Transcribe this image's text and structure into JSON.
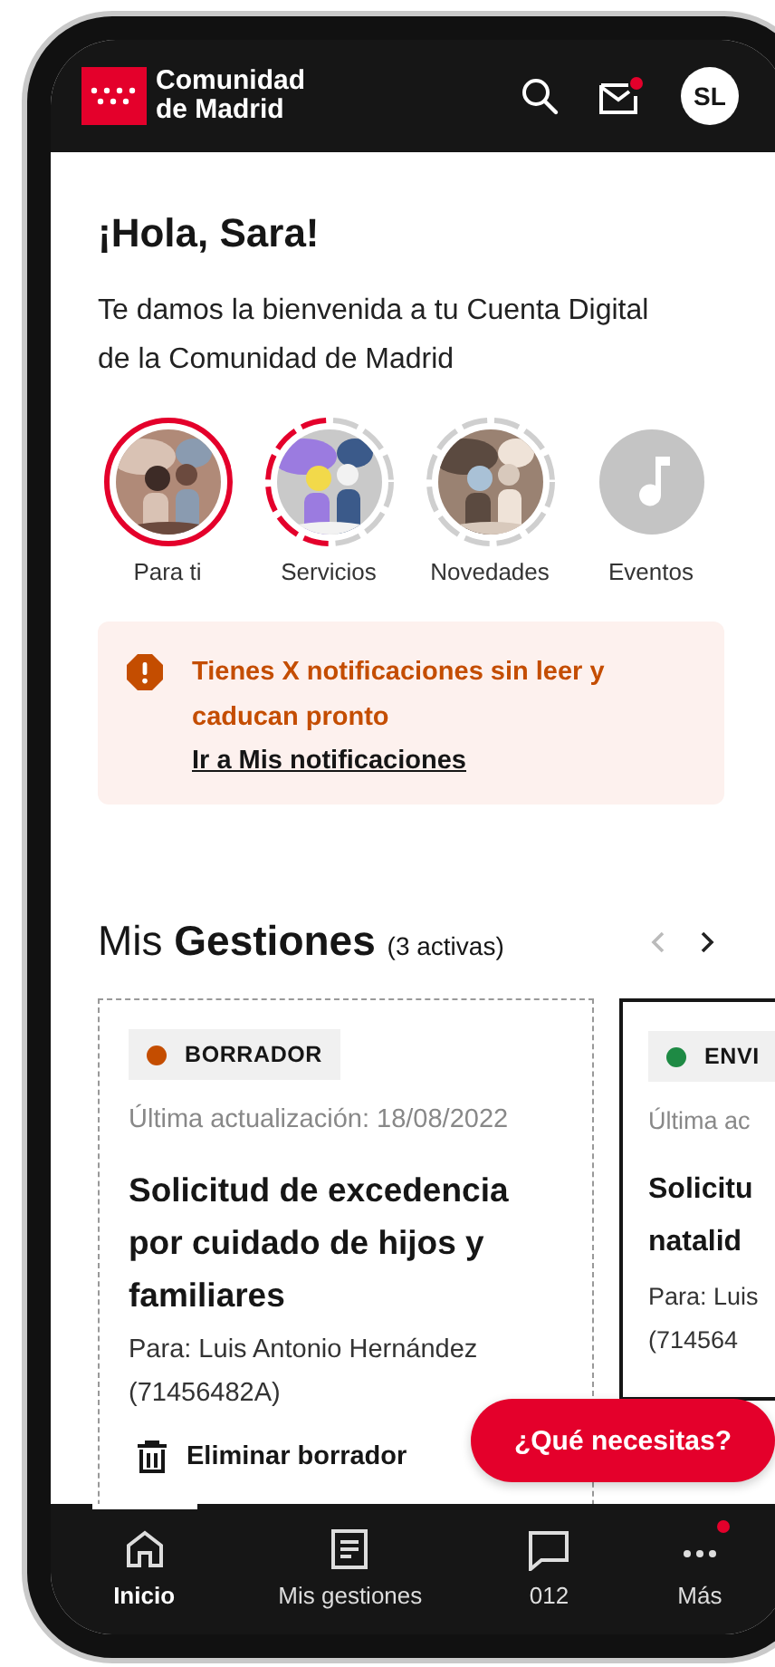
{
  "header": {
    "logo_line1": "Comunidad",
    "logo_line2": "de Madrid",
    "mail_unread": true,
    "avatar": "SL"
  },
  "greeting": "¡Hola, Sara!",
  "intro": "Te damos la bienvenida a tu Cuenta Digital de la Comunidad de Madrid",
  "stories": [
    {
      "label": "Para ti",
      "kind": "new"
    },
    {
      "label": "Servicios",
      "kind": "partial"
    },
    {
      "label": "Novedades",
      "kind": "seen"
    },
    {
      "label": "Eventos",
      "kind": "icon"
    }
  ],
  "alert": {
    "message": "Tienes X notificaciones sin leer y caducan pronto",
    "link": "Ir a Mis notificaciones"
  },
  "gestiones": {
    "title_plain": "Mis",
    "title_bold": "Gestiones",
    "count": "(3 activas)",
    "prev_disabled": true,
    "next_disabled": false
  },
  "cards": [
    {
      "status": "BORRADOR",
      "color": "#c44d00",
      "updated": "Última actualización: 18/08/2022",
      "title": "Solicitud de excedencia por cuidado de hijos y familiares",
      "recipient": "Para: Luis Antonio Hernández (71456482A)",
      "action": "Eliminar borrador"
    },
    {
      "status": "ENVI",
      "color": "#1e8a44",
      "updated": "Última ac",
      "title_lines": [
        "Solicitu",
        "natalid"
      ],
      "recipient_lines": [
        "Para: Luis",
        "(714564"
      ]
    }
  ],
  "fab": "¿Qué necesitas?",
  "nav": [
    {
      "label": "Inicio",
      "kind": "home",
      "selected": true,
      "badge": false
    },
    {
      "label": "Mis gestiones",
      "kind": "doc",
      "selected": false,
      "badge": false
    },
    {
      "label": "012",
      "kind": "chat",
      "selected": false,
      "badge": false
    },
    {
      "label": "Más",
      "kind": "more",
      "selected": false,
      "badge": true
    }
  ]
}
